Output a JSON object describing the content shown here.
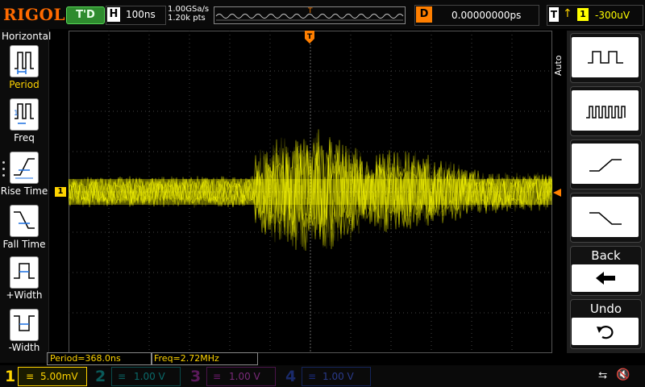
{
  "top": {
    "brand": "RIGOL",
    "run_status": "T'D",
    "horizontal_label": "H",
    "timebase": "100ns",
    "sample_rate": "1.00GSa/s",
    "memory_depth": "1.20k pts",
    "memory_trigger_marker": "T",
    "delay_label": "D",
    "delay_value": "0.00000000ps",
    "trigger_label": "T",
    "trigger_source": "1",
    "trigger_level": "-300uV"
  },
  "left_menu": {
    "title": "Horizontal",
    "items": [
      {
        "label": "Period",
        "icon": "period-icon"
      },
      {
        "label": "Freq",
        "icon": "frequency-icon"
      },
      {
        "label": "Rise Time",
        "icon": "rise-time-icon"
      },
      {
        "label": "Fall Time",
        "icon": "fall-time-icon"
      },
      {
        "label": "+Width",
        "icon": "positive-width-icon"
      },
      {
        "label": "-Width",
        "icon": "negative-width-icon"
      }
    ]
  },
  "waveform": {
    "channel_marker": "1",
    "trigger_marker": "T",
    "color": "#ffff00"
  },
  "right_menu": {
    "mode": "Auto",
    "buttons": [
      {
        "icon": "square-wave-low-freq-icon"
      },
      {
        "icon": "square-wave-high-freq-icon"
      },
      {
        "icon": "rising-edge-icon"
      },
      {
        "icon": "falling-edge-icon"
      },
      {
        "label": "Back",
        "icon": "back-arrow-icon"
      },
      {
        "label": "Undo",
        "icon": "undo-icon"
      }
    ]
  },
  "measurements": [
    {
      "text": "Period=368.0ns"
    },
    {
      "text": "Freq=2.72MHz"
    }
  ],
  "channels": [
    {
      "num": "1",
      "scale": "5.00mV",
      "color": "#ffd400",
      "active": true
    },
    {
      "num": "2",
      "scale": "1.00 V",
      "color": "#00c0c0",
      "active": false
    },
    {
      "num": "3",
      "scale": "1.00 V",
      "color": "#e040e0",
      "active": false
    },
    {
      "num": "4",
      "scale": "1.00 V",
      "color": "#2060ff",
      "active": false
    }
  ],
  "status_icons": {
    "usb": "usb-icon",
    "speaker": "speaker-muted-icon"
  }
}
